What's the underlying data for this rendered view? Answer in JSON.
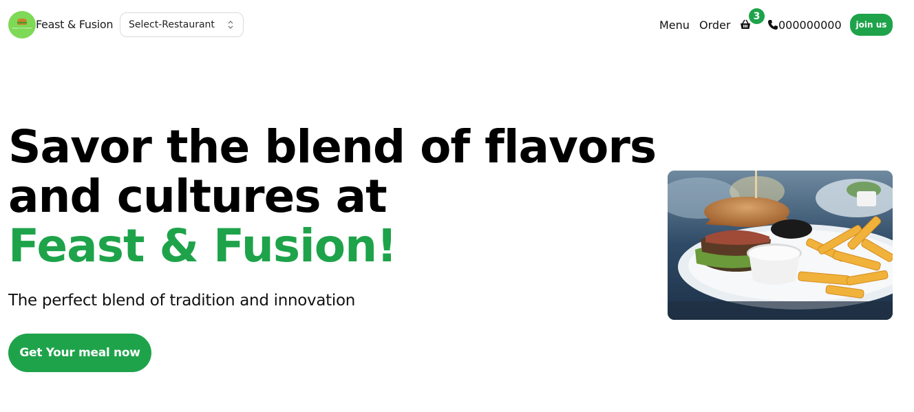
{
  "header": {
    "brand": "Feast & Fusion",
    "logo_text": "FEAST & FUSION",
    "select": {
      "value": "Select-Restaurant"
    },
    "nav": {
      "menu": "Menu",
      "order": "Order"
    },
    "cart_count": "3",
    "phone": "000000000",
    "join_label": "join us"
  },
  "hero": {
    "title_line1": "Savor the blend of flavors",
    "title_line2": "and cultures at",
    "title_accent": "Feast & Fusion!",
    "subtitle": "The perfect blend of tradition and innovation",
    "cta_label": "Get Your meal now"
  },
  "colors": {
    "accent": "#1ea34a",
    "logo_bg": "#7ed957"
  },
  "icons": {
    "cart": "basket-icon",
    "phone": "phone-icon",
    "select": "chevron-updown-icon"
  }
}
